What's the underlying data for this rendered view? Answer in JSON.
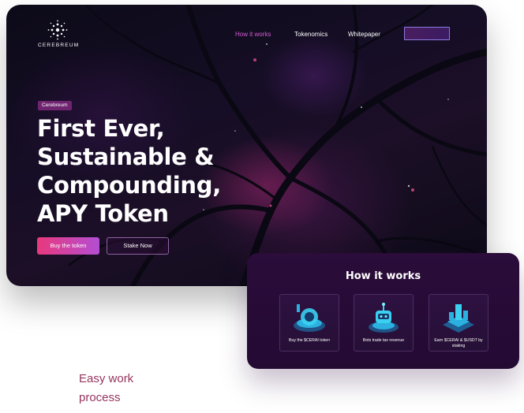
{
  "brand": {
    "logo_text": "CEREBREUM",
    "accent": "#d65bd3"
  },
  "nav": {
    "items": [
      "How it works",
      "Tokenomics",
      "Whitepaper"
    ],
    "button_label": ""
  },
  "hero": {
    "badge": "Cerebreum",
    "headline_lines": [
      "First Ever,",
      "Sustainable &",
      "Compounding,",
      "APY Token"
    ],
    "buy_button": "Buy the token",
    "stake_button": "Stake Now"
  },
  "how_it_works": {
    "title": "How it works",
    "steps": [
      {
        "label": "Buy the $CERAI token",
        "icon": "coin-platform-icon"
      },
      {
        "label": "Bots trade tax revenue",
        "icon": "robot-icon"
      },
      {
        "label": "Earn $CERAI & $USDT by staking",
        "icon": "staking-tower-icon"
      }
    ]
  },
  "section_subtitle": "Easy work process",
  "colors": {
    "buy_gradient": [
      "#e8397d",
      "#b34ed3"
    ],
    "subtitle": "#96345f",
    "card_bg": "#2b0c3a"
  }
}
